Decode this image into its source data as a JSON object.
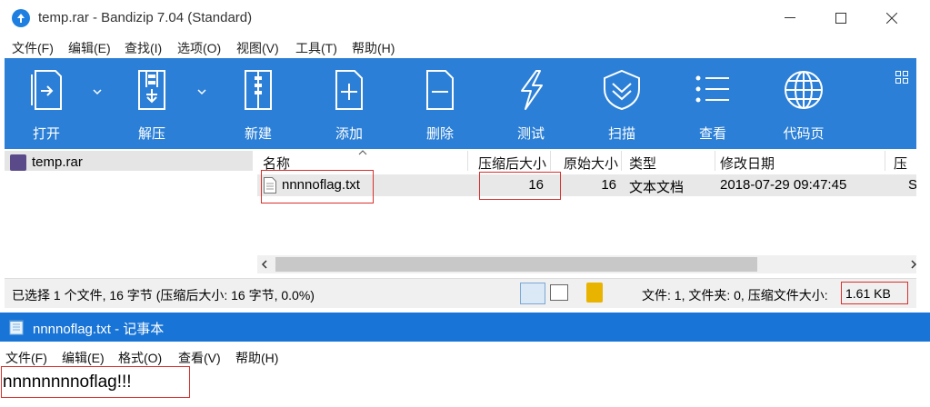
{
  "bandizip": {
    "title": "temp.rar - Bandizip 7.04 (Standard)",
    "menu": [
      "文件(F)",
      "编辑(E)",
      "查找(I)",
      "选项(O)",
      "视图(V)",
      "工具(T)",
      "帮助(H)"
    ],
    "toolbar": [
      {
        "label": "打开",
        "icon": "open-icon"
      },
      {
        "label": "解压",
        "icon": "extract-icon"
      },
      {
        "label": "新建",
        "icon": "new-archive-icon"
      },
      {
        "label": "添加",
        "icon": "add-icon"
      },
      {
        "label": "删除",
        "icon": "delete-icon"
      },
      {
        "label": "测试",
        "icon": "test-icon"
      },
      {
        "label": "扫描",
        "icon": "scan-shield-icon"
      },
      {
        "label": "查看",
        "icon": "view-list-icon"
      },
      {
        "label": "代码页",
        "icon": "globe-icon"
      }
    ],
    "tree": {
      "root": "temp.rar"
    },
    "columns": [
      "名称",
      "压缩后大小",
      "原始大小",
      "类型",
      "修改日期",
      "压缩..."
    ],
    "files": [
      {
        "name": "nnnnoflag.txt",
        "packed": "16",
        "original": "16",
        "type": "文本文档",
        "modified": "2018-07-29 09:47:45",
        "method": "St"
      }
    ],
    "status_left": "已选择 1 个文件, 16 字节 (压缩后大小: 16 字节, 0.0%)",
    "status_right_prefix": "文件: 1, 文件夹: 0, 压缩文件大小:",
    "status_archive_size": "1.61 KB"
  },
  "notepad": {
    "title": "nnnnoflag.txt - 记事本",
    "menu": [
      "文件(F)",
      "编辑(E)",
      "格式(O)",
      "查看(V)",
      "帮助(H)"
    ],
    "content": "nnnnnnnnoflag!!!"
  },
  "colors": {
    "toolbar": "#2b7fd6",
    "notepad_title": "#1874d6",
    "highlight": "#d9302c"
  }
}
